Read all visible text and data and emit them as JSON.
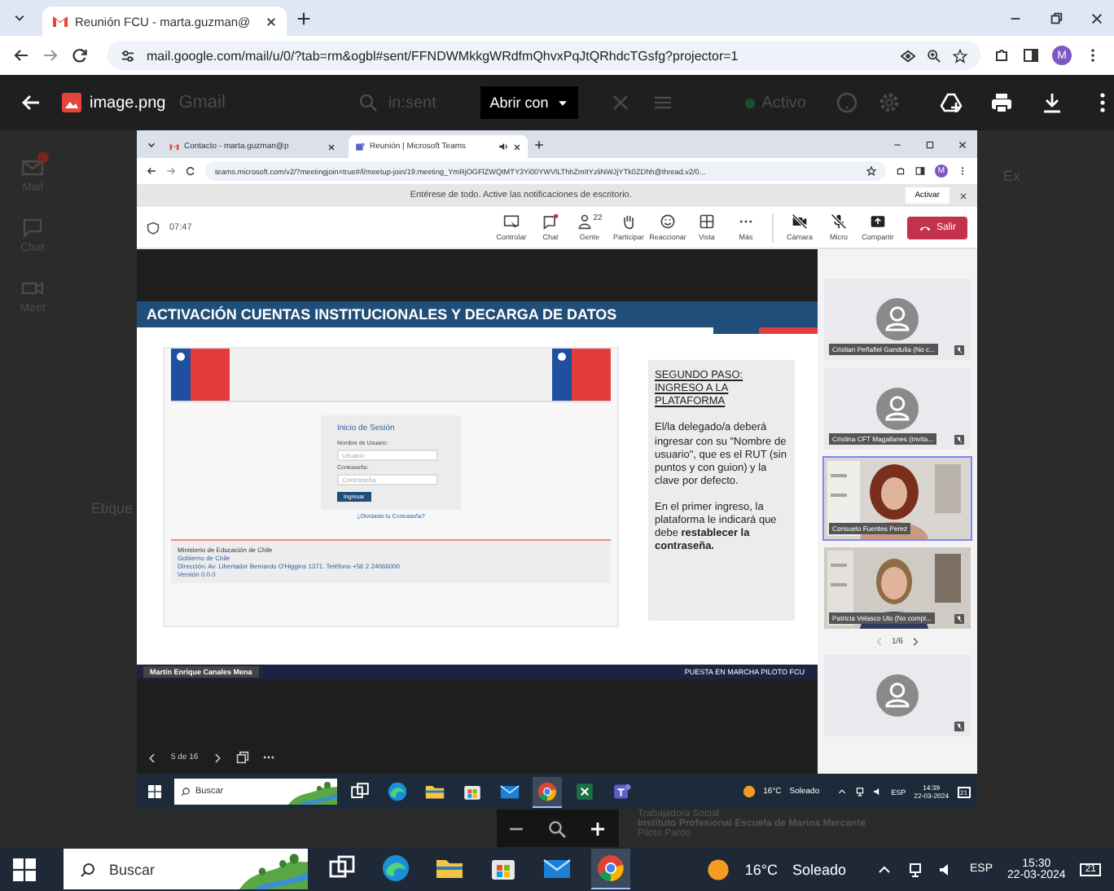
{
  "browser": {
    "tab_title": "Reunión FCU - marta.guzman@",
    "url": "mail.google.com/mail/u/0/?tab=rm&ogbl#sent/FFNDWMkkgWRdfmQhvxPqJtQRhdcTGsfg?projector=1",
    "avatar": "M"
  },
  "viewer": {
    "file_name": "image.png",
    "open_with": "Abrir con"
  },
  "gmail_behind": {
    "app_name": "Gmail",
    "search": "in:sent",
    "status": "Activo",
    "nav": [
      {
        "label": "Mail",
        "kind": "mail",
        "unread": true
      },
      {
        "label": "Chat",
        "kind": "chat",
        "unread": false
      },
      {
        "label": "Meet",
        "kind": "meet",
        "unread": false
      }
    ],
    "labels_heading": "Etique",
    "right_label": "Ex",
    "signature": [
      {
        "text": "Trabajadora Social",
        "bold": false
      },
      {
        "text": "Instituto Profesional Escuela de Marina Mercante",
        "bold": true
      },
      {
        "text": "Piloto Pardo",
        "bold": false
      }
    ]
  },
  "screenshot": {
    "tabs": [
      {
        "title": "Contacto - marta.guzman@p",
        "audio": false,
        "selected": false
      },
      {
        "title": "Reunión | Microsoft Teams",
        "audio": true,
        "selected": true
      }
    ],
    "url": "teams.microsoft.com/v2/?meetingjoin=true#/l/meetup-join/19:meeting_YmRjOGFlZWQtMTY3Yi00YWVlLThhZmItYzliNWJjYTk0ZDhh@thread.v2/0...",
    "avatar": "M",
    "notice": "Entérese de todo. Active las notificaciones de escritorio.",
    "notice_action": "Activar",
    "clock": "07:47",
    "tools": [
      {
        "kind": "control",
        "label": "Controlar"
      },
      {
        "kind": "chat",
        "label": "Chat"
      },
      {
        "kind": "people",
        "label": "Gente",
        "count": "22"
      },
      {
        "kind": "hand",
        "label": "Participar"
      },
      {
        "kind": "smile",
        "label": "Reaccionar"
      },
      {
        "kind": "grid",
        "label": "Vista"
      },
      {
        "kind": "more",
        "label": "Más"
      }
    ],
    "devices": [
      {
        "kind": "camera",
        "label": "Cámara",
        "off": true
      },
      {
        "kind": "mic",
        "label": "Micro",
        "off": true
      },
      {
        "kind": "share",
        "label": "Compartir",
        "off": false
      }
    ],
    "leave": "Salir",
    "slide": {
      "title": "ACTIVACIÓN CUENTAS INSTITUCIONALES Y DECARGA DE DATOS",
      "login": {
        "heading": "Inicio de Sesión",
        "user_label": "Nombre de Usuario:",
        "user_placeholder": "Usuario",
        "pass_label": "Contraseña:",
        "pass_placeholder": "Contraseña",
        "submit": "Ingresar",
        "forgot": "¿Olvidaste tu Contraseña?",
        "footer": [
          "Ministerio de Educación de Chile",
          "Gobierno de Chile",
          "Dirección: Av. Libertador Bernardo O'Higgins 1371. Teléfono +56 2 24066000",
          "Versión 0.0.0"
        ]
      },
      "step_heading": "SEGUNDO PASO: INGRESO A LA PLATAFORMA",
      "paragraphs": [
        "El/la delegado/a deberá ingresar con su \"Nombre de usuario\", que es el RUT (sin puntos y con guion) y la clave por defecto.",
        "En el primer ingreso, la plataforma le indicará que debe **restablecer la contraseña.**"
      ]
    },
    "presenter": "Martín Enrique Canales Mena",
    "deck_footer": "PUESTA EN MARCHA PILOTO FCU",
    "slide_counter": "5 de 16",
    "participants": [
      {
        "kind": "avatar",
        "name": "Cristian Peñafiel Gandulia (No c...",
        "muted": true,
        "speaking": false
      },
      {
        "kind": "avatar",
        "name": "Cristina CFT Magallanes (Invita...",
        "muted": true,
        "speaking": false
      },
      {
        "kind": "video",
        "name": "Consuelo Fuentes Perez",
        "muted": false,
        "speaking": true
      },
      {
        "kind": "video",
        "name": "Patricia Velasco Ulo (No compi...",
        "muted": true,
        "speaking": false
      }
    ],
    "gallery_page": "1/6",
    "participants_below": [
      {
        "kind": "avatar",
        "muted": true,
        "speaking": false
      }
    ],
    "taskbar": {
      "search": "Buscar",
      "apps": [
        {
          "kind": "taskview",
          "active": false
        },
        {
          "kind": "edge",
          "active": false
        },
        {
          "kind": "explorer",
          "active": false
        },
        {
          "kind": "store",
          "active": false
        },
        {
          "kind": "mail",
          "active": false
        },
        {
          "kind": "chrome",
          "active": true
        },
        {
          "kind": "excel",
          "active": false
        },
        {
          "kind": "teams",
          "active": false
        }
      ],
      "temperature": "16°C",
      "weather": "Soleado",
      "language": "ESP",
      "time": "14:39",
      "date": "22-03-2024",
      "notifications": "21"
    }
  },
  "taskbar": {
    "search": "Buscar",
    "apps": [
      {
        "kind": "taskview",
        "active": false
      },
      {
        "kind": "edge",
        "active": false
      },
      {
        "kind": "explorer",
        "active": false
      },
      {
        "kind": "store",
        "active": false
      },
      {
        "kind": "mail",
        "active": false
      },
      {
        "kind": "chrome",
        "active": true
      }
    ],
    "temperature": "16°C",
    "weather": "Soleado",
    "language": "ESP",
    "time": "15:30",
    "date": "22-03-2024",
    "notifications": "21"
  }
}
